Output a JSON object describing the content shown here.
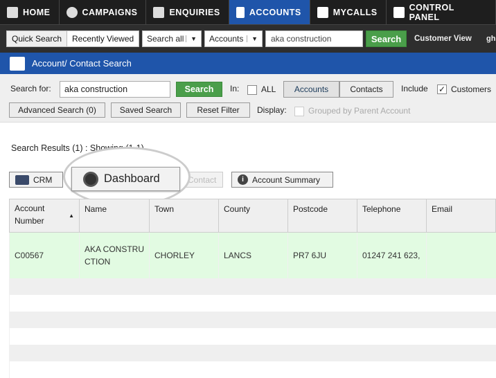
{
  "nav": {
    "tabs": [
      {
        "label": "HOME",
        "icon": "home-icon"
      },
      {
        "label": "CAMPAIGNS",
        "icon": "campaigns-icon"
      },
      {
        "label": "ENQUIRIES",
        "icon": "enquiries-icon"
      },
      {
        "label": "ACCOUNTS",
        "icon": "bank-icon",
        "active": true
      },
      {
        "label": "MYCALLS",
        "icon": "checklist-icon"
      },
      {
        "label": "CONTROL PANEL",
        "icon": "sliders-icon"
      }
    ]
  },
  "toolbar": {
    "quick_search": "Quick Search",
    "recently_viewed": "Recently Viewed",
    "search_scope": "Search all",
    "search_type": "Accounts",
    "query": "aka construction",
    "search": "Search",
    "customer_view": "Customer View",
    "overflow": "gh th"
  },
  "header": {
    "title": "Account/ Contact Search"
  },
  "filters": {
    "search_for_label": "Search for:",
    "search_for_value": "aka construction",
    "search": "Search",
    "in_label": "In:",
    "all_label": "ALL",
    "all_checked": false,
    "accounts": "Accounts",
    "contacts": "Contacts",
    "include_label": "Include",
    "customers_label": "Customers",
    "customers_checked": true,
    "advanced_search": "Advanced Search (0)",
    "saved_search": "Saved Search",
    "reset_filter": "Reset Filter",
    "display_label": "Display:",
    "grouped_label": "Grouped by Parent Account",
    "grouped_checked": false
  },
  "results": {
    "summary": "Search Results (1) : Showing (1-1)",
    "buttons": {
      "crm": "CRM",
      "dashboard": "Dashboard",
      "contact": "Contact",
      "account_summary": "Account Summary"
    }
  },
  "table": {
    "columns": [
      "Account Number",
      "Name",
      "Town",
      "County",
      "Postcode",
      "Telephone",
      "Email"
    ],
    "rows": [
      [
        "C00567",
        "AKA CONSTRUCTION",
        "CHORLEY",
        "LANCS",
        "PR7 6JU",
        "01247 241 623,",
        ""
      ]
    ]
  },
  "colors": {
    "nav_active": "#1f55aa",
    "search_green": "#4a9e4a",
    "selected_row": "#e2fbe2"
  }
}
